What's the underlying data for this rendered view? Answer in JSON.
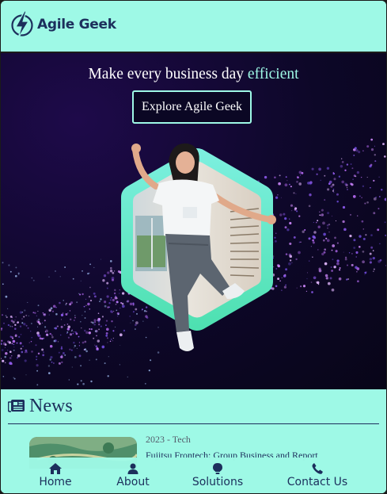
{
  "header": {
    "brand": "Agile Geek",
    "logo_icon": "lightning-bolt-icon"
  },
  "hero": {
    "headline_prefix": "Make every business day ",
    "headline_accent": "efficient",
    "cta_label": "Explore Agile Geek"
  },
  "news": {
    "title": "News",
    "icon": "newspaper-icon",
    "items": [
      {
        "meta": "2023 - Tech",
        "headline": "Fujitsu Frontech: Group Business and Report"
      }
    ]
  },
  "nav": {
    "items": [
      {
        "label": "Home",
        "icon": "home-icon"
      },
      {
        "label": "About",
        "icon": "user-icon"
      },
      {
        "label": "Solutions",
        "icon": "lightbulb-icon"
      },
      {
        "label": "Contact Us",
        "icon": "phone-icon"
      }
    ]
  },
  "colors": {
    "mint": "#9ef9e6",
    "navy": "#1c2f5c",
    "hero_dark": "#0d0728",
    "particle_purple": "#b86cf5"
  }
}
